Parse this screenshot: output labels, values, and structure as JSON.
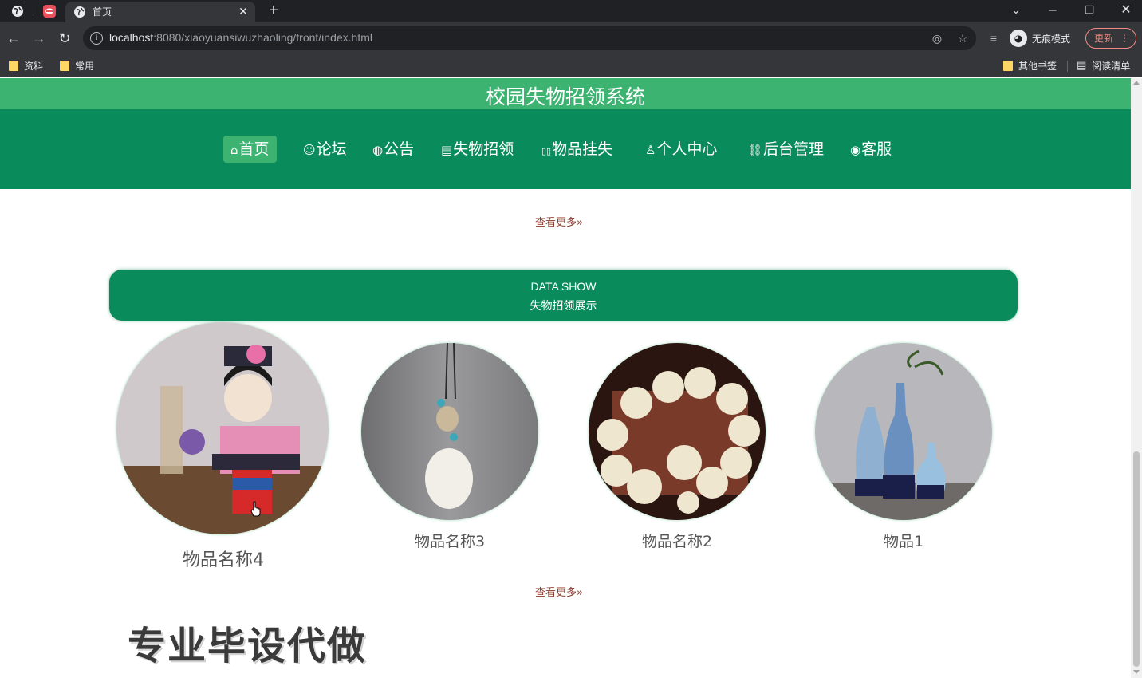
{
  "browser": {
    "tab_title": "首页",
    "url_host": "localhost",
    "url_rest": ":8080/xiaoyuansiwuzhaoling/front/index.html",
    "profile_label": "无痕模式",
    "update_label": "更新",
    "bookmarks": [
      "资料",
      "常用"
    ],
    "bookmarks_right": [
      "其他书签",
      "阅读清单"
    ]
  },
  "site": {
    "title": "校园失物招领系统",
    "nav": [
      {
        "icon": "home-icon",
        "glyph": "⌂",
        "label": "首页"
      },
      {
        "icon": "forum-icon",
        "glyph": "☺",
        "label": "论坛"
      },
      {
        "icon": "notice-icon",
        "glyph": "◍",
        "label": "公告"
      },
      {
        "icon": "document-icon",
        "glyph": "▤",
        "label": "失物招领"
      },
      {
        "icon": "report-icon",
        "glyph": "▯▯",
        "label": "物品挂失"
      },
      {
        "icon": "user-icon",
        "glyph": "♙",
        "label": "个人中心"
      },
      {
        "icon": "link-icon",
        "glyph": "⛓",
        "label": "后台管理"
      },
      {
        "icon": "service-icon",
        "glyph": "◉",
        "label": "客服"
      }
    ],
    "more_label": "查看更多",
    "section": {
      "title_en": "DATA SHOW",
      "title_cn": "失物招领展示"
    },
    "items": [
      {
        "name": "物品名称4",
        "image": "doll-figurine"
      },
      {
        "name": "物品名称3",
        "image": "pendant"
      },
      {
        "name": "物品名称2",
        "image": "bead-bracelet"
      },
      {
        "name": "物品1",
        "image": "vases"
      }
    ],
    "watermark": "专业毕设代做"
  },
  "colors": {
    "primary_green": "#0a8b5c",
    "light_green": "#3cb371",
    "more_link": "#8b3a2b"
  }
}
